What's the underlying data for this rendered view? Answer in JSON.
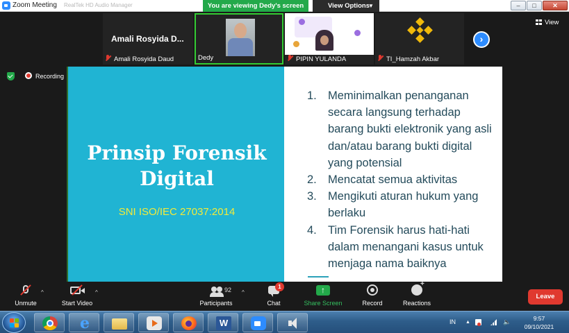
{
  "window": {
    "app_title": "Zoom Meeting",
    "ghost_title": "RealTek HD Audio Manager",
    "viewing_banner": "You are viewing Dedy's screen",
    "view_options": "View Options",
    "minimize": "–",
    "maximize": "□",
    "close": "✕"
  },
  "strip": {
    "tiles": [
      {
        "name_big": "Amali Rosyida D...",
        "label": "Amali Rosyida Daud",
        "muted": true
      },
      {
        "label": "Dedy",
        "muted": false,
        "active": true
      },
      {
        "label": "PIPIN YULANDA",
        "muted": true
      },
      {
        "label": "TI_Hamzah Akbar",
        "muted": true
      }
    ],
    "view_label": "View",
    "next_icon": "chevron-right-icon"
  },
  "recording": {
    "label": "Recording"
  },
  "slide": {
    "title": "Prinsip Forensik Digital",
    "subtitle": "SNI ISO/IEC 27037:2014",
    "items": [
      {
        "num": "1.",
        "text": "Meminimalkan penanganan secara langsung terhadap barang bukti elektronik yang asli dan/atau barang bukti digital yang potensial"
      },
      {
        "num": "2.",
        "text": "Mencatat semua aktivitas"
      },
      {
        "num": "3.",
        "text": "Mengikuti aturan hukum yang berlaku"
      },
      {
        "num": "4.",
        "text": "Tim Forensik harus hati-hati dalam menangani kasus untuk menjaga nama baiknya"
      }
    ],
    "colors": {
      "left_bg": "#20b4d3",
      "title": "#ffffff",
      "subtitle": "#f2ea3a",
      "list_text": "#244b5b"
    }
  },
  "toolbar": {
    "unmute": "Unmute",
    "start_video": "Start Video",
    "participants": "Participants",
    "participants_count": "92",
    "chat": "Chat",
    "chat_badge": "1",
    "share_screen": "Share Screen",
    "record": "Record",
    "reactions": "Reactions",
    "leave": "Leave",
    "colors": {
      "accent_green": "#23a94a",
      "leave_red": "#e0392f",
      "zoom_blue": "#2d8cff"
    }
  },
  "taskbar": {
    "apps": [
      "chrome-icon",
      "internet-explorer-icon",
      "file-explorer-icon",
      "media-player-icon",
      "firefox-icon",
      "word-icon",
      "zoom-icon",
      "speaker-icon"
    ],
    "language": "IN",
    "time": "9:57",
    "date": "09/10/2021"
  }
}
